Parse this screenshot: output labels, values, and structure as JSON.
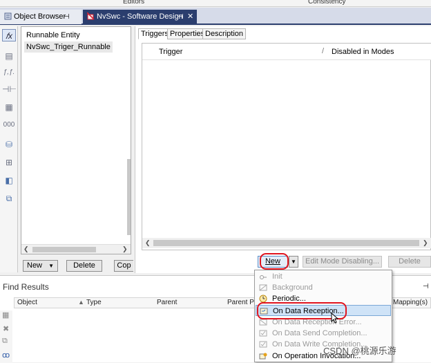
{
  "top_strip": {
    "left_label": "Editors",
    "right_label": "Consistency"
  },
  "tabs": [
    {
      "label": "Object Browser",
      "pin": "⊣"
    },
    {
      "label": "NvSwc - Software Design",
      "pin": "⊣",
      "close": "✕"
    }
  ],
  "runnables": {
    "items": [
      "Runnable Entity",
      "NvSwc_Triger_Runnable"
    ],
    "buttons": {
      "new": "New",
      "delete": "Delete",
      "copy": "Cop"
    }
  },
  "detail": {
    "subtabs": [
      "Triggers",
      "Properties",
      "Description"
    ],
    "columns": [
      "Trigger",
      "Disabled in Modes"
    ],
    "buttons": {
      "new": "New",
      "edit_mode": "Edit Mode Disabling...",
      "delete": "Delete"
    }
  },
  "find": {
    "title": "Find Results",
    "columns": [
      "Object",
      "Type",
      "Parent",
      "Parent Pat",
      "Mapping(s)"
    ]
  },
  "menu": {
    "items": [
      {
        "label": "Init",
        "enabled": false,
        "icon": "init-icon"
      },
      {
        "label": "Background",
        "enabled": false,
        "icon": "background-icon"
      },
      {
        "label": "Periodic...",
        "enabled": true,
        "icon": "clock-icon"
      },
      {
        "label": "On Data Reception...",
        "enabled": true,
        "highlighted": true,
        "icon": "data-reception-icon"
      },
      {
        "label": "On Data Reception Error...",
        "enabled": false,
        "icon": "data-reception-error-icon"
      },
      {
        "label": "On Data Send Completion...",
        "enabled": false,
        "icon": "send-completion-icon"
      },
      {
        "label": "On Data Write Completion...",
        "enabled": false,
        "icon": "write-completion-icon"
      },
      {
        "label": "On Operation Invocation...",
        "enabled": true,
        "icon": "operation-invocation-icon"
      }
    ]
  },
  "watermark": "CSDN @桃源乐游",
  "colors": {
    "tab_active": "#2b3e6e",
    "highlight": "#cfe3f7",
    "annotation": "#e0141e"
  }
}
